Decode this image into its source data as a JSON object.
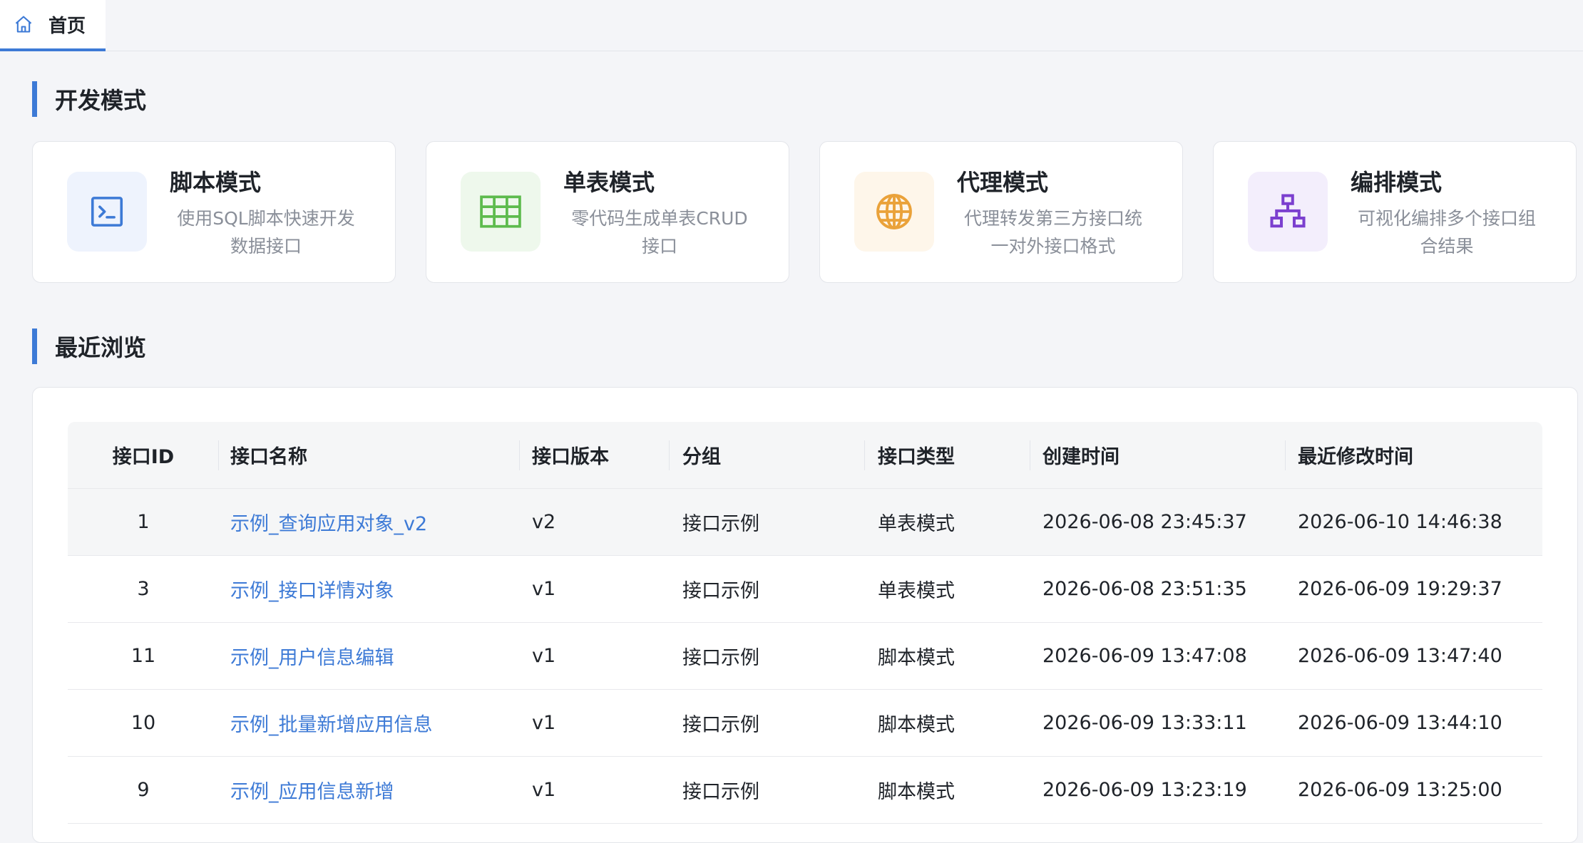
{
  "tab": {
    "label": "首页",
    "icon": "home-icon"
  },
  "dev_section": {
    "title": "开发模式"
  },
  "cards": [
    {
      "title": "脚本模式",
      "desc": "使用SQL脚本快速开发数据接口",
      "icon": "terminal-icon",
      "color": "#3d7ad6",
      "bg": "#eef3fd"
    },
    {
      "title": "单表模式",
      "desc": "零代码生成单表CRUD接口",
      "icon": "table-icon",
      "color": "#5dbb4d",
      "bg": "#eef8ec"
    },
    {
      "title": "代理模式",
      "desc": "代理转发第三方接口统一对外接口格式",
      "icon": "globe-icon",
      "color": "#eaa23a",
      "bg": "#fef6ea"
    },
    {
      "title": "编排模式",
      "desc": "可视化编排多个接口组合结果",
      "icon": "sitemap-icon",
      "color": "#7b3fcf",
      "bg": "#f3eefc"
    }
  ],
  "recent_section": {
    "title": "最近浏览"
  },
  "table": {
    "columns": [
      "接口ID",
      "接口名称",
      "接口版本",
      "分组",
      "接口类型",
      "创建时间",
      "最近修改时间"
    ],
    "rows": [
      {
        "id": "1",
        "name": "示例_查询应用对象_v2",
        "version": "v2",
        "group": "接口示例",
        "type": "单表模式",
        "created": "2026-06-08 23:45:37",
        "modified": "2026-06-10 14:46:38"
      },
      {
        "id": "3",
        "name": "示例_接口详情对象",
        "version": "v1",
        "group": "接口示例",
        "type": "单表模式",
        "created": "2026-06-08 23:51:35",
        "modified": "2026-06-09 19:29:37"
      },
      {
        "id": "11",
        "name": "示例_用户信息编辑",
        "version": "v1",
        "group": "接口示例",
        "type": "脚本模式",
        "created": "2026-06-09 13:47:08",
        "modified": "2026-06-09 13:47:40"
      },
      {
        "id": "10",
        "name": "示例_批量新增应用信息",
        "version": "v1",
        "group": "接口示例",
        "type": "脚本模式",
        "created": "2026-06-09 13:33:11",
        "modified": "2026-06-09 13:44:10"
      },
      {
        "id": "9",
        "name": "示例_应用信息新增",
        "version": "v1",
        "group": "接口示例",
        "type": "脚本模式",
        "created": "2026-06-09 13:23:19",
        "modified": "2026-06-09 13:25:00"
      }
    ]
  },
  "colors": {
    "accent": "#3d7ad6",
    "link": "#3d7ad6"
  }
}
